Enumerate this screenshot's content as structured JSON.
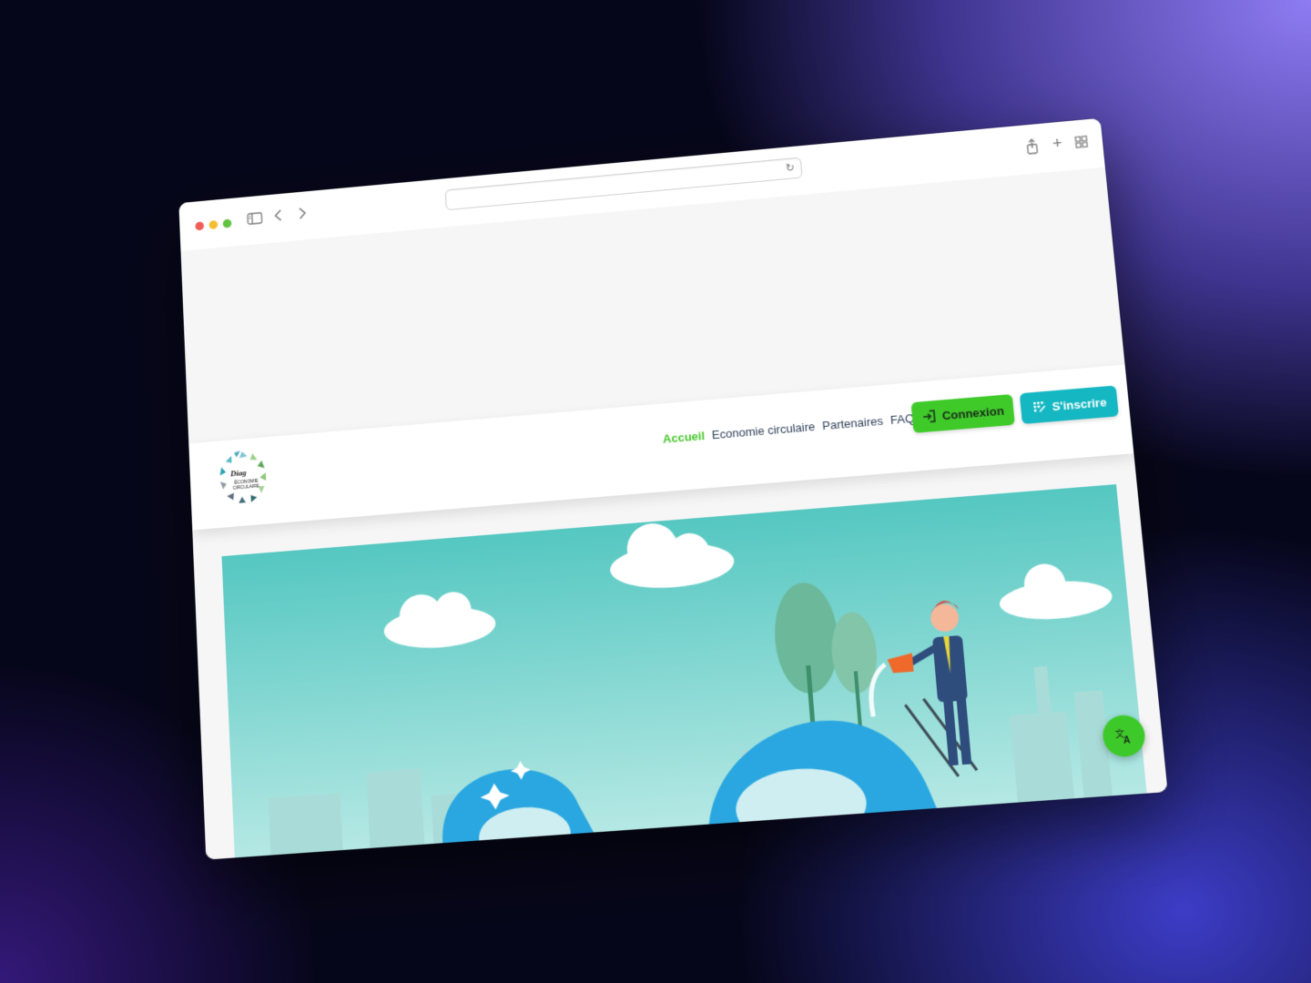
{
  "browser": {
    "url": "",
    "icons": {
      "sidebar": "sidebar-icon",
      "back": "chevron-left-icon",
      "forward": "chevron-right-icon",
      "reload": "reload-icon",
      "share": "share-icon",
      "new_tab": "plus-icon",
      "tabs_overview": "grid-icon"
    }
  },
  "header": {
    "logo_text": "Diag ÉCONOMIE CIRCULAIRE",
    "nav": [
      {
        "label": "Accueil",
        "active": true
      },
      {
        "label": "Economie circulaire",
        "active": false
      },
      {
        "label": "Partenaires",
        "active": false
      },
      {
        "label": "FAQ",
        "active": false
      }
    ],
    "login_label": "Connexion",
    "signup_label": "S'inscrire"
  },
  "colors": {
    "accent_green": "#3fca2a",
    "accent_teal": "#15b7c2",
    "nav_text": "#2e3f57",
    "hero_sky": "#5fcbc6"
  },
  "fab": {
    "icon": "translate-icon"
  }
}
